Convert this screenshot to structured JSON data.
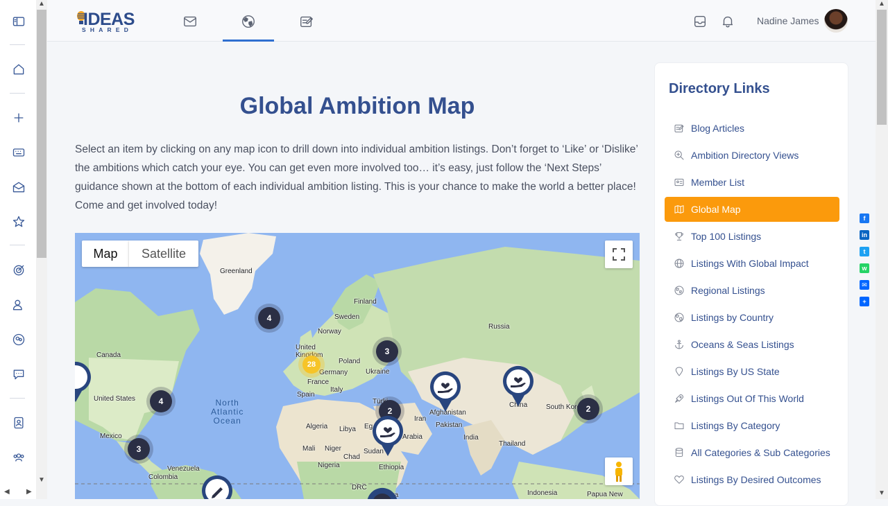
{
  "header": {
    "logo_text": "IDEAS",
    "logo_subtext": "SHARED",
    "user_name": "Nadine James"
  },
  "main": {
    "title": "Global Ambition Map",
    "intro": "Select an item by clicking on any map icon to drill down into individual ambition listings. Don’t forget to ‘Like’ or ‘Dislike’ the ambitions which catch your eye. You can get even more involved too… it’s easy, just follow the ‘Next Steps’ guidance shown at the bottom of each individual ambition listing. This is your chance to make the world a better place! Come and get involved today!"
  },
  "map": {
    "tabs": {
      "map": "Map",
      "satellite": "Satellite"
    },
    "labels": {
      "greenland": "Greenland",
      "finland": "Finland",
      "sweden": "Sweden",
      "norway": "Norway",
      "russia": "Russia",
      "united_kingdom": "United\nKingdom",
      "poland": "Poland",
      "germany": "Germany",
      "ukraine": "Ukraine",
      "france": "France",
      "spain": "Spain",
      "italy": "Italy",
      "turkiye": "Türki",
      "canada": "Canada",
      "united_states": "United States",
      "mexico": "Mexico",
      "ocean": "North\nAtlantic\nOcean",
      "algeria": "Algeria",
      "libya": "Libya",
      "egypt": "Eg",
      "saudi_arabia": "Arabia",
      "iran": "Iran",
      "afghanistan": "Afghanistan",
      "pakistan": "Pakistan",
      "india": "India",
      "china": "China",
      "south_korea": "South Kore",
      "thailand": "Thailand",
      "mali": "Mali",
      "niger": "Niger",
      "chad": "Chad",
      "sudan": "Sudan",
      "nigeria": "Nigeria",
      "ethiopia": "Ethiopia",
      "venezuela": "Venezuela",
      "colombia": "Colombia",
      "drc": "DRC",
      "kenya": "Kenya",
      "indonesia": "Indonesia",
      "papua": "Papua New"
    },
    "clusters": {
      "greenland_sea": "4",
      "uk": "28",
      "east_europe": "3",
      "usa_east": "4",
      "mexico_gulf": "3",
      "middle_east": "2",
      "korea": "2"
    }
  },
  "sidebar": {
    "title": "Directory Links",
    "items": [
      {
        "label": "Blog Articles",
        "icon": "blog-icon"
      },
      {
        "label": "Ambition Directory Views",
        "icon": "search-plus-icon"
      },
      {
        "label": "Member List",
        "icon": "id-card-icon"
      },
      {
        "label": "Global Map",
        "icon": "map-icon",
        "active": true
      },
      {
        "label": "Top 100 Listings",
        "icon": "trophy-icon"
      },
      {
        "label": "Listings With Global Impact",
        "icon": "globe-icon"
      },
      {
        "label": "Regional Listings",
        "icon": "globe-regions-icon"
      },
      {
        "label": "Listings by Country",
        "icon": "globe-country-icon"
      },
      {
        "label": "Oceans & Seas Listings",
        "icon": "anchor-icon"
      },
      {
        "label": "Listings By US State",
        "icon": "location-pin-icon"
      },
      {
        "label": "Listings Out Of This World",
        "icon": "rocket-icon"
      },
      {
        "label": "Listings By Category",
        "icon": "folder-icon"
      },
      {
        "label": "All Categories & Sub Categories",
        "icon": "database-icon"
      },
      {
        "label": "Listings By Desired Outcomes",
        "icon": "heart-icon"
      }
    ]
  },
  "colors": {
    "accent": "#fb9a0c",
    "brand": "#34508f",
    "map_water": "#8fb6f0",
    "cluster": "#2b2f45"
  }
}
